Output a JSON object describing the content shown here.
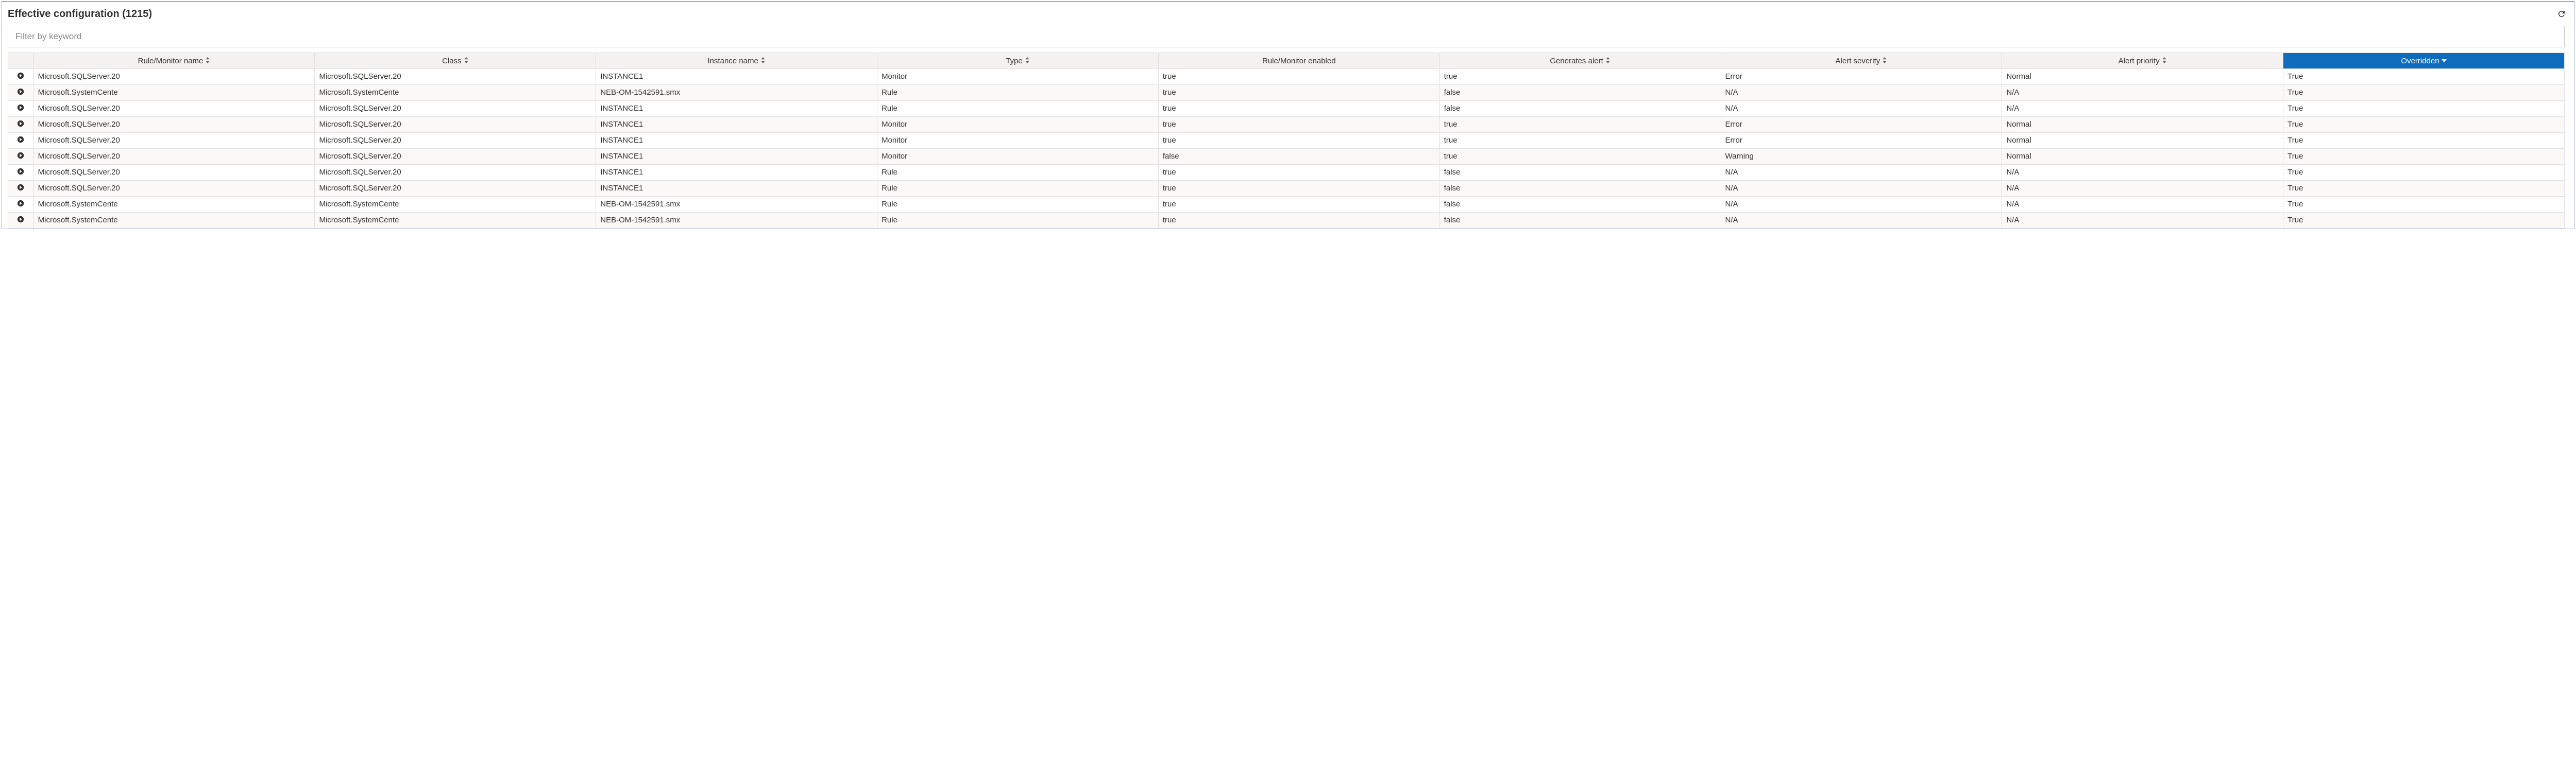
{
  "header": {
    "title": "Effective configuration (1215)"
  },
  "filter": {
    "placeholder": "Filter by keyword",
    "value": ""
  },
  "columns": [
    {
      "label": "Rule/Monitor name",
      "sortable": true,
      "sorted": false
    },
    {
      "label": "Class",
      "sortable": true,
      "sorted": false
    },
    {
      "label": "Instance name",
      "sortable": true,
      "sorted": false
    },
    {
      "label": "Type",
      "sortable": true,
      "sorted": false
    },
    {
      "label": "Rule/Monitor enabled",
      "sortable": false,
      "sorted": false
    },
    {
      "label": "Generates alert",
      "sortable": true,
      "sorted": false
    },
    {
      "label": "Alert severity",
      "sortable": true,
      "sorted": false
    },
    {
      "label": "Alert priority",
      "sortable": true,
      "sorted": false
    },
    {
      "label": "Overridden",
      "sortable": true,
      "sorted": true,
      "dir": "desc"
    }
  ],
  "rows": [
    {
      "name": "Microsoft.SQLServer.20",
      "class": "Microsoft.SQLServer.20",
      "instance": "INSTANCE1",
      "type": "Monitor",
      "enabled": "true",
      "alert": "true",
      "severity": "Error",
      "priority": "Normal",
      "overridden": "True"
    },
    {
      "name": "Microsoft.SystemCente",
      "class": "Microsoft.SystemCente",
      "instance": "NEB-OM-1542591.smx",
      "type": "Rule",
      "enabled": "true",
      "alert": "false",
      "severity": "N/A",
      "priority": "N/A",
      "overridden": "True"
    },
    {
      "name": "Microsoft.SQLServer.20",
      "class": "Microsoft.SQLServer.20",
      "instance": "INSTANCE1",
      "type": "Rule",
      "enabled": "true",
      "alert": "false",
      "severity": "N/A",
      "priority": "N/A",
      "overridden": "True"
    },
    {
      "name": "Microsoft.SQLServer.20",
      "class": "Microsoft.SQLServer.20",
      "instance": "INSTANCE1",
      "type": "Monitor",
      "enabled": "true",
      "alert": "true",
      "severity": "Error",
      "priority": "Normal",
      "overridden": "True"
    },
    {
      "name": "Microsoft.SQLServer.20",
      "class": "Microsoft.SQLServer.20",
      "instance": "INSTANCE1",
      "type": "Monitor",
      "enabled": "true",
      "alert": "true",
      "severity": "Error",
      "priority": "Normal",
      "overridden": "True"
    },
    {
      "name": "Microsoft.SQLServer.20",
      "class": "Microsoft.SQLServer.20",
      "instance": "INSTANCE1",
      "type": "Monitor",
      "enabled": "false",
      "alert": "true",
      "severity": "Warning",
      "priority": "Normal",
      "overridden": "True"
    },
    {
      "name": "Microsoft.SQLServer.20",
      "class": "Microsoft.SQLServer.20",
      "instance": "INSTANCE1",
      "type": "Rule",
      "enabled": "true",
      "alert": "false",
      "severity": "N/A",
      "priority": "N/A",
      "overridden": "True"
    },
    {
      "name": "Microsoft.SQLServer.20",
      "class": "Microsoft.SQLServer.20",
      "instance": "INSTANCE1",
      "type": "Rule",
      "enabled": "true",
      "alert": "false",
      "severity": "N/A",
      "priority": "N/A",
      "overridden": "True"
    },
    {
      "name": "Microsoft.SystemCente",
      "class": "Microsoft.SystemCente",
      "instance": "NEB-OM-1542591.smx",
      "type": "Rule",
      "enabled": "true",
      "alert": "false",
      "severity": "N/A",
      "priority": "N/A",
      "overridden": "True"
    },
    {
      "name": "Microsoft.SystemCente",
      "class": "Microsoft.SystemCente",
      "instance": "NEB-OM-1542591.smx",
      "type": "Rule",
      "enabled": "true",
      "alert": "false",
      "severity": "N/A",
      "priority": "N/A",
      "overridden": "True"
    }
  ],
  "icons": {
    "refresh": "refresh-icon",
    "sort_both": "sort-both-icon",
    "sort_desc": "sort-desc-icon",
    "expand": "chevron-right-circle-icon"
  }
}
